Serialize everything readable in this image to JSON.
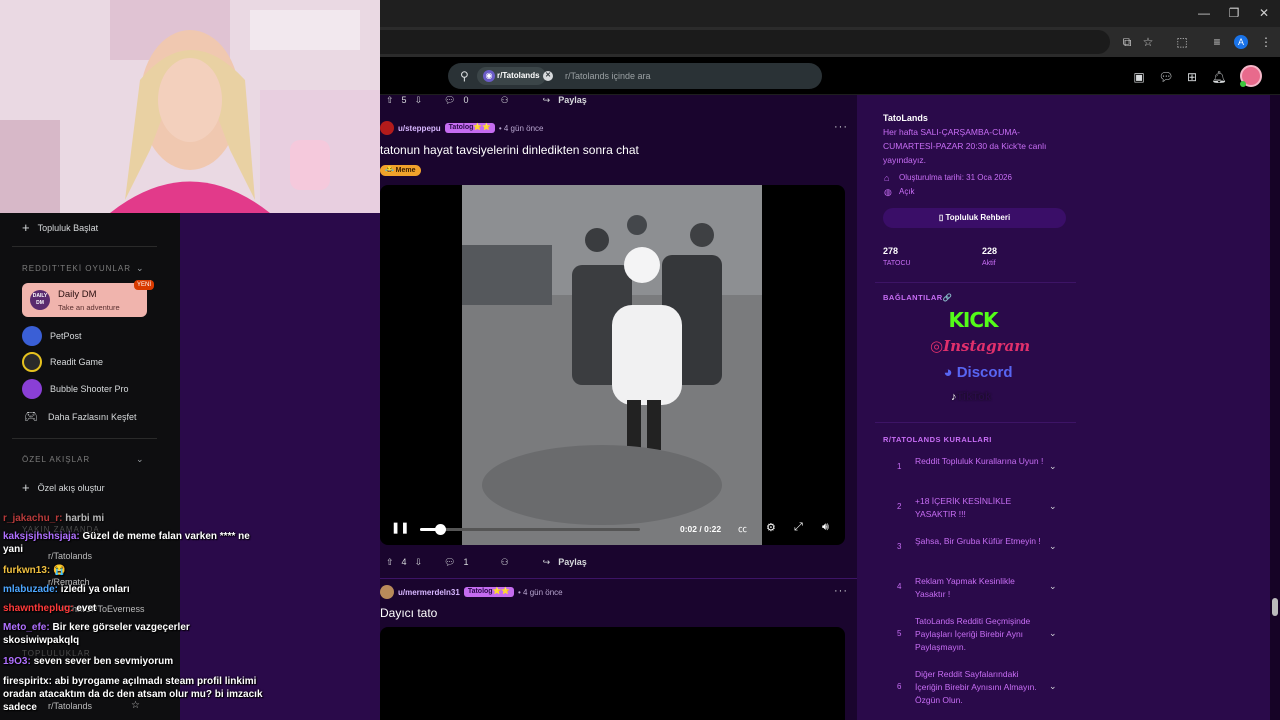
{
  "browser": {
    "window_controls": [
      "—",
      "❐",
      "✕"
    ],
    "ext_icons": [
      "⧉",
      "☆",
      "⬚",
      "≡",
      "⋮"
    ],
    "profile_letter": "A"
  },
  "header": {
    "community_chip": "r/Tatolands",
    "search_placeholder": "r/Tatolands içinde ara"
  },
  "post1_bar": {
    "upvotes": "5",
    "comments": "0",
    "share": "Paylaş"
  },
  "post2": {
    "user": "u/steppepu",
    "flair": "Tatolog⭐⭐",
    "time": "• 4 gün önce",
    "title": "tatonun hayat tavsiyelerini dinledikten sonra chat",
    "tag": "😂 Meme",
    "video_time": "0:02 / 0:22",
    "video_progress": 0.09,
    "upvotes": "4",
    "comments": "1",
    "share": "Paylaş",
    "more": "···"
  },
  "post3": {
    "user": "u/mermerdeln31",
    "flair": "Tatolog⭐⭐",
    "time": "• 4 gün önce",
    "title": "Dayıcı tato",
    "more": "···"
  },
  "left_nav": {
    "start_community": "Topluluk Başlat",
    "games_section": "REDDIT'TEKİ OYUNLAR",
    "daily_title": "Daily DM",
    "daily_sub": "Take an adventure",
    "daily_icon": "DAILY DM",
    "new_badge": "YENİ",
    "games": [
      "PetPost",
      "Readit Game",
      "Bubble Shooter Pro"
    ],
    "explore_more": "Daha Fazlasını Keşfet",
    "custom_section": "ÖZEL AKIŞLAR",
    "create_custom": "Özel akış oluştur",
    "recent_section": "YAKIN ZAMANDA",
    "recent": [
      "r/Tatolands",
      "r/Rematch",
      "r/ChatGPToEverness"
    ],
    "communities_section": "TOPLULUKLAR",
    "community_last": "r/Tatolands"
  },
  "chat": [
    {
      "user": "r_jakachu_r:",
      "text": "harbi mi",
      "color": "#ff4d4d"
    },
    {
      "user": "kaksjsjhshsjaja:",
      "text": "Güzel de meme falan varken **** ne yani",
      "color": "#b070ff"
    },
    {
      "user": "furkwn13:",
      "text": "😭",
      "color": "#f0c040"
    },
    {
      "user": "mlabuzade:",
      "text": "izledi ya onları",
      "color": "#4da6ff"
    },
    {
      "user": "shawntheplug:",
      "text": "evet",
      "color": "#ff3b3b"
    },
    {
      "user": "Meto_efe:",
      "text": "Bir kere görseler vazgeçerler skosiwiwpakqlq",
      "color": "#b070ff"
    },
    {
      "user": "19O3:",
      "text": "seven sever ben sevmiyorum",
      "color": "#b070ff"
    },
    {
      "user": "firespiritx:",
      "text": "abi byrogame açılmadı steam profil linkimi oradan atacaktım da dc den atsam olur mu? bi imzacık sadece",
      "color": "#ffffff"
    }
  ],
  "sidebar": {
    "name": "TatoLands",
    "description": "Her hafta SALI-ÇARŞAMBA-CUMA-CUMARTESİ-PAZAR 20:30 da Kick'te canlı yayındayız.",
    "created": "Oluşturulma tarihi: 31 Oca 2026",
    "visibility": "Açık",
    "guide_button": "Topluluk Rehberi",
    "members": "278",
    "members_label": "TATOCU",
    "online": "228",
    "online_label": "Aktif",
    "links_title": "BAĞLANTILAR🔗",
    "links": {
      "kick": "KICK",
      "instagram": "Instagram",
      "discord": "Discord",
      "tiktok": "TikTok"
    },
    "rules_title": "R/TATOLANDS KURALLARI",
    "rules": [
      {
        "num": "1",
        "text": "Reddit Topluluk Kurallarına Uyun !"
      },
      {
        "num": "2",
        "text": "+18 İÇERİK KESİNLİKLE YASAKTIR !!!"
      },
      {
        "num": "3",
        "text": "Şahsa, Bir Gruba Küfür Etmeyin !"
      },
      {
        "num": "4",
        "text": "Reklam Yapmak Kesinlikle Yasaktır !"
      },
      {
        "num": "5",
        "text": "TatoLands Redditi Geçmişinde Paylaşları İçeriği Birebir Aynı Paylaşmayın."
      },
      {
        "num": "6",
        "text": "Diğer Reddit Sayfalarındaki İçeriğin Birebir Aynısını Almayın. Özgün Olun."
      }
    ]
  },
  "colors": {
    "feed_bg": "#1a052e",
    "sidebar_bg": "#2a0a4a",
    "accent": "#c86ef5",
    "kick": "#53fc18",
    "discord": "#5865f2"
  }
}
